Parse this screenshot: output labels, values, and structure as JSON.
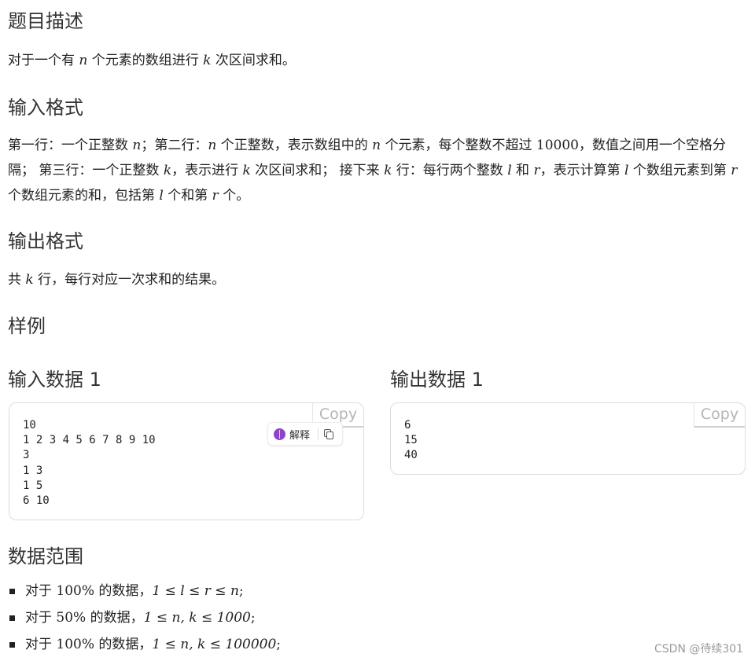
{
  "h_desc": "题目描述",
  "desc": {
    "a": "对于一个有 ",
    "n": "n",
    "b": " 个元素的数组进行 ",
    "k": "k",
    "c": " 次区间求和。"
  },
  "h_input": "输入格式",
  "input": {
    "s1": "第一行：一个正整数 ",
    "n1": "n",
    "s2": "；第二行：",
    "n2": "n",
    "s3": " 个正整数，表示数组中的 ",
    "n3": "n",
    "s4": " 个元素，每个整数不超过 ",
    "v1": "10000",
    "s5": "，数值之间用一个空格分隔； 第三行：一个正整数 ",
    "k1": "k",
    "s6": "，表示进行 ",
    "k2": "k",
    "s7": " 次区间求和； 接下来 ",
    "k3": "k",
    "s8": " 行：每行两个整数 ",
    "l1": "l",
    "s9": " 和 ",
    "r1": "r",
    "s10": "，表示计算第 ",
    "l2": "l",
    "s11": " 个数组元素到第 ",
    "r2": "r",
    "s12": " 个数组元素的和，包括第 ",
    "l3": "l",
    "s13": " 个和第 ",
    "r3": "r",
    "s14": " 个。"
  },
  "h_output": "输出格式",
  "output": {
    "a": "共 ",
    "k": "k",
    "b": " 行，每行对应一次求和的结果。"
  },
  "h_sample": "样例",
  "sample_in_title": "输入数据 1",
  "sample_out_title": "输出数据 1",
  "sample_in": "10\n1 2 3 4 5 6 7 8 9 10\n3\n1 3\n1 5\n6 10",
  "sample_out": "6\n15\n40",
  "copy_label": "Copy",
  "explain_label": "解释",
  "icons": {
    "explain": "brain-icon",
    "copy": "copy-icon"
  },
  "h_range": "数据范围",
  "ranges": [
    {
      "a": "对于 ",
      "pct": "100%",
      "b": " 的数据，",
      "expr": "1 ≤ l ≤ r ≤ n",
      "end": ";"
    },
    {
      "a": "对于 ",
      "pct": "50%",
      "b": " 的数据，",
      "expr": "1 ≤ n, k ≤ 1000",
      "end": ";"
    },
    {
      "a": "对于 ",
      "pct": "100%",
      "b": " 的数据，",
      "expr": "1 ≤ n, k ≤ 100000",
      "end": ";"
    }
  ],
  "watermark": "CSDN @待续301"
}
